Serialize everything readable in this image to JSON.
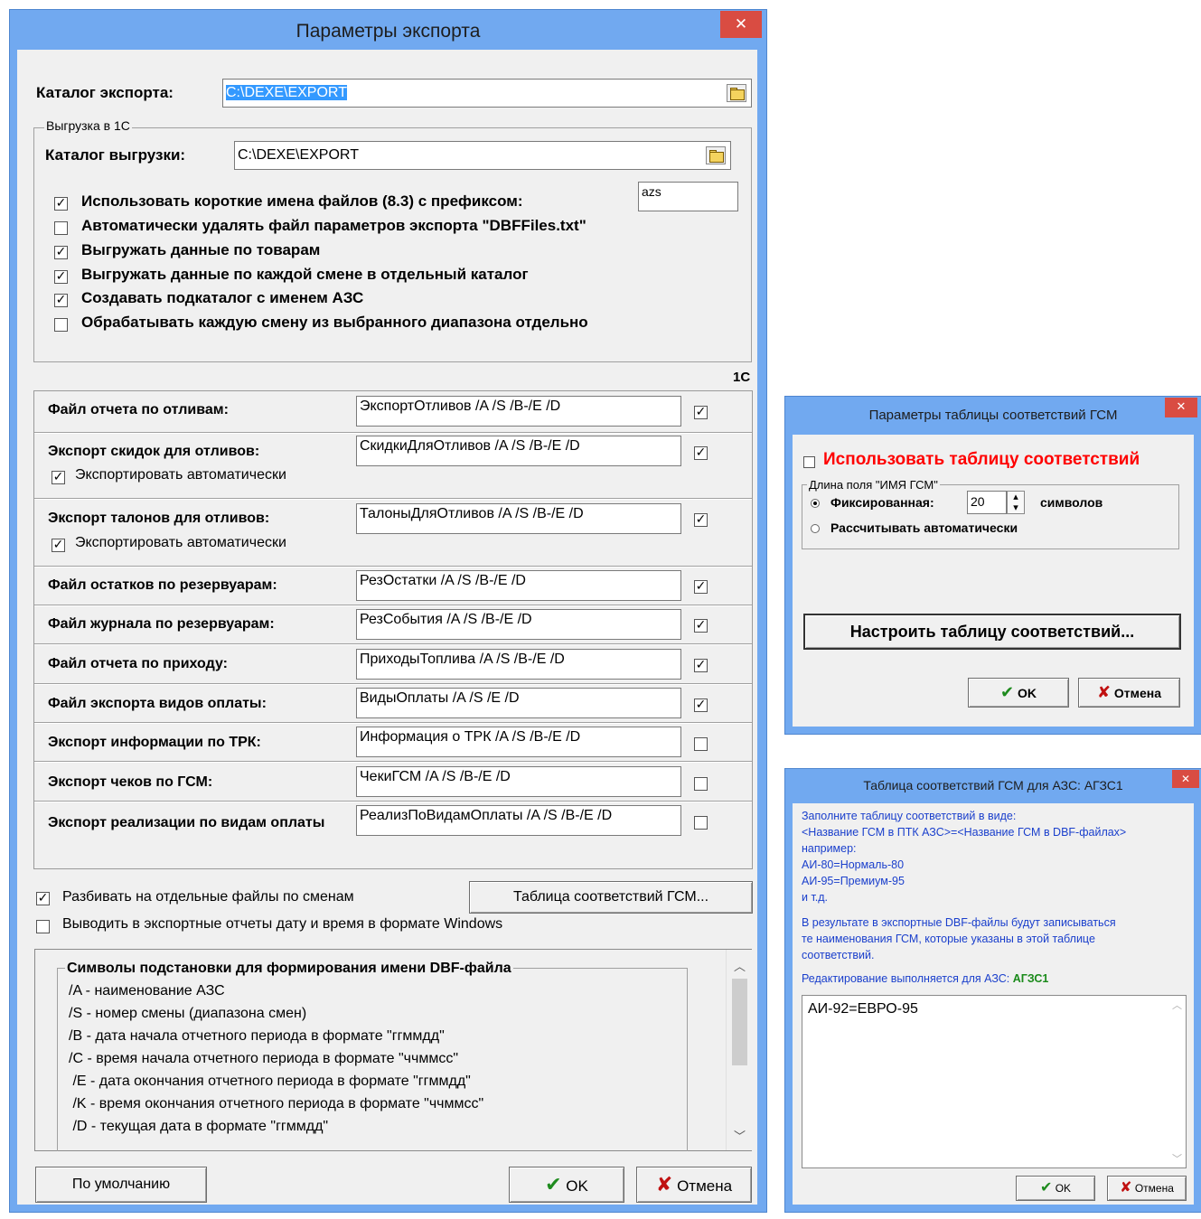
{
  "main": {
    "title": "Параметры экспорта",
    "close_glyph": "✕",
    "catalog_label": "Каталог экспорта:",
    "catalog_value": "C:\\DEXE\\EXPORT",
    "group1c": {
      "caption": "Выгрузка в 1С",
      "catalog_label": "Каталог выгрузки:",
      "catalog_value": "C:\\DEXE\\EXPORT",
      "prefix_value": "azs",
      "options": [
        {
          "label": "Использовать короткие имена файлов (8.3) с префиксом:",
          "checked": true
        },
        {
          "label": "Автоматически удалять файл параметров экспорта \"DBFFiles.txt\"",
          "checked": false
        },
        {
          "label": "Выгружать данные по товарам",
          "checked": true
        },
        {
          "label": "Выгружать данные по каждой смене в отдельный каталог",
          "checked": true
        },
        {
          "label": "Создавать подкаталог с именем АЗС",
          "checked": true
        },
        {
          "label": "Обрабатывать каждую смену из выбранного диапазона отдельно",
          "checked": false
        }
      ]
    },
    "col_1c": "1С",
    "rows": [
      {
        "label": "Файл отчета по отливам:",
        "value": "ЭкспортОтливов /A /S /B-/E /D",
        "checked": true
      },
      {
        "label": "Экспорт скидок для отливов:",
        "value": "СкидкиДляОтливов /A /S /B-/E /D",
        "checked": true,
        "sub": "Экспортировать автоматически",
        "sub_checked": true
      },
      {
        "label": "Экспорт талонов для отливов:",
        "value": "ТалоныДляОтливов /A /S /B-/E /D",
        "checked": true,
        "sub": "Экспортировать автоматически",
        "sub_checked": true
      },
      {
        "label": "Файл остатков по резервуарам:",
        "value": "РезОстатки /A /S /B-/E /D",
        "checked": true
      },
      {
        "label": "Файл журнала по резервуарам:",
        "value": "РезСобытия /A /S /B-/E /D",
        "checked": true
      },
      {
        "label": "Файл отчета по приходу:",
        "value": "ПриходыТоплива /A /S /B-/E /D",
        "checked": true
      },
      {
        "label": "Файл экспорта видов оплаты:",
        "value": "ВидыОплаты /A /S /E /D",
        "checked": true
      },
      {
        "label": "Экспорт информации по ТРК:",
        "value": "Информация о ТРК /A /S /B-/E /D",
        "checked": false
      },
      {
        "label": "Экспорт чеков по ГСМ:",
        "value": "ЧекиГСМ  /A /S /B-/E /D",
        "checked": false
      },
      {
        "label": "Экспорт реализации по видам оплаты",
        "value": "РеализПоВидамОплаты /A /S /B-/E /D",
        "checked": false
      }
    ],
    "split_label": "Разбивать на отдельные файлы по сменам",
    "split_checked": true,
    "gsm_table_button": "Таблица соответствий ГСМ...",
    "windows_dt_label": "Выводить в экспортные отчеты дату и время в формате Windows",
    "windows_dt_checked": false,
    "symbols_caption": "Символы подстановки для формирования имени DBF-файла",
    "symbols": [
      "/A - наименование АЗС",
      "/S - номер смены (диапазона смен)",
      "/B - дата начала отчетного периода в формате \"ггммдд\"",
      "/C - время начала отчетного периода в формате \"ччммсс\"",
      " /E - дата окончания отчетного периода в формате \"ггммдд\"",
      " /K - время окончания отчетного периода в формате \"ччммсс\"",
      " /D - текущая дата в формате \"ггммдд\""
    ],
    "default_button": "По умолчанию",
    "ok_button": "OK",
    "cancel_button": "Отмена"
  },
  "params_dialog": {
    "title": "Параметры таблицы соответствий ГСМ",
    "use_table_label": "Использовать таблицу соответствий",
    "use_table_checked": false,
    "group_caption": "Длина поля \"ИМЯ ГСМ\"",
    "fixed_label": "Фиксированная:",
    "fixed_value": "20",
    "symbols_label": "символов",
    "auto_label": "Рассчитывать автоматически",
    "mode": "fixed",
    "configure_button": "Настроить таблицу соответствий...",
    "ok_button": "OK",
    "cancel_button": "Отмена"
  },
  "table_dialog": {
    "title": "Таблица соответствий ГСМ для АЗС: АГЗС1",
    "info_lines": [
      "Заполните таблицу соответствий в виде:",
      "<Название ГСМ в ПТК АЗС>=<Название ГСМ в DBF-файлах>",
      "например:",
      "АИ-80=Нормаль-80",
      "АИ-95=Премиум-95",
      "и т.д."
    ],
    "result_lines": [
      "В результате в экспортные DBF-файлы будут записываться",
      "те наименования ГСМ, которые указаны в этой таблице",
      "соответствий."
    ],
    "edit_prefix": "Редактирование выполняется для АЗС: ",
    "edit_station": "АГЗС1",
    "text": "АИ-92=ЕВРО-95",
    "ok_button": "OK",
    "cancel_button": "Отмена"
  },
  "colors": {
    "titlebar": "#71a9f0",
    "close": "#d94c42",
    "info_text": "#1a3fcc",
    "red_label": "#ff0000",
    "station": "#1a8a1a"
  }
}
